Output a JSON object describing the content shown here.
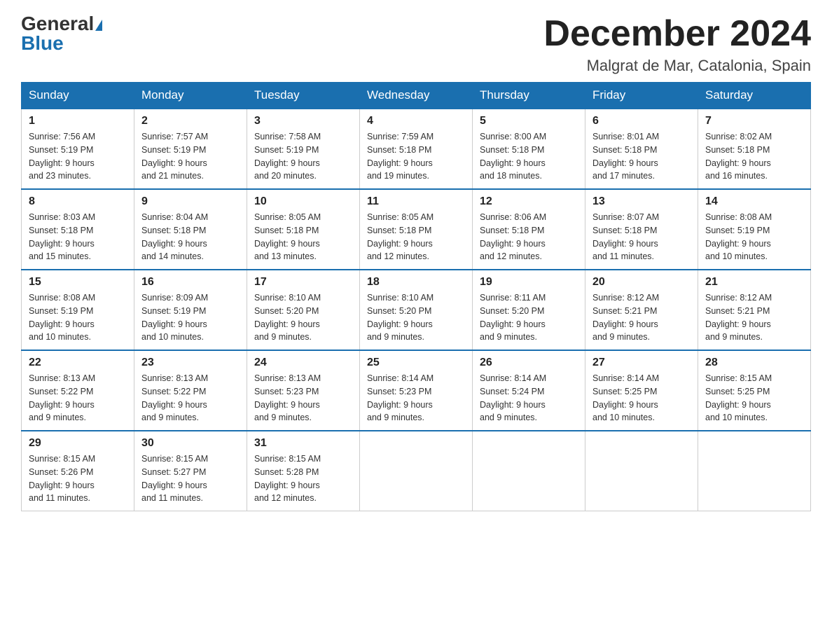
{
  "logo": {
    "general": "General",
    "blue": "Blue"
  },
  "header": {
    "month": "December 2024",
    "location": "Malgrat de Mar, Catalonia, Spain"
  },
  "weekdays": [
    "Sunday",
    "Monday",
    "Tuesday",
    "Wednesday",
    "Thursday",
    "Friday",
    "Saturday"
  ],
  "weeks": [
    [
      {
        "day": "1",
        "sunrise": "7:56 AM",
        "sunset": "5:19 PM",
        "daylight": "9 hours and 23 minutes."
      },
      {
        "day": "2",
        "sunrise": "7:57 AM",
        "sunset": "5:19 PM",
        "daylight": "9 hours and 21 minutes."
      },
      {
        "day": "3",
        "sunrise": "7:58 AM",
        "sunset": "5:19 PM",
        "daylight": "9 hours and 20 minutes."
      },
      {
        "day": "4",
        "sunrise": "7:59 AM",
        "sunset": "5:18 PM",
        "daylight": "9 hours and 19 minutes."
      },
      {
        "day": "5",
        "sunrise": "8:00 AM",
        "sunset": "5:18 PM",
        "daylight": "9 hours and 18 minutes."
      },
      {
        "day": "6",
        "sunrise": "8:01 AM",
        "sunset": "5:18 PM",
        "daylight": "9 hours and 17 minutes."
      },
      {
        "day": "7",
        "sunrise": "8:02 AM",
        "sunset": "5:18 PM",
        "daylight": "9 hours and 16 minutes."
      }
    ],
    [
      {
        "day": "8",
        "sunrise": "8:03 AM",
        "sunset": "5:18 PM",
        "daylight": "9 hours and 15 minutes."
      },
      {
        "day": "9",
        "sunrise": "8:04 AM",
        "sunset": "5:18 PM",
        "daylight": "9 hours and 14 minutes."
      },
      {
        "day": "10",
        "sunrise": "8:05 AM",
        "sunset": "5:18 PM",
        "daylight": "9 hours and 13 minutes."
      },
      {
        "day": "11",
        "sunrise": "8:05 AM",
        "sunset": "5:18 PM",
        "daylight": "9 hours and 12 minutes."
      },
      {
        "day": "12",
        "sunrise": "8:06 AM",
        "sunset": "5:18 PM",
        "daylight": "9 hours and 12 minutes."
      },
      {
        "day": "13",
        "sunrise": "8:07 AM",
        "sunset": "5:18 PM",
        "daylight": "9 hours and 11 minutes."
      },
      {
        "day": "14",
        "sunrise": "8:08 AM",
        "sunset": "5:19 PM",
        "daylight": "9 hours and 10 minutes."
      }
    ],
    [
      {
        "day": "15",
        "sunrise": "8:08 AM",
        "sunset": "5:19 PM",
        "daylight": "9 hours and 10 minutes."
      },
      {
        "day": "16",
        "sunrise": "8:09 AM",
        "sunset": "5:19 PM",
        "daylight": "9 hours and 10 minutes."
      },
      {
        "day": "17",
        "sunrise": "8:10 AM",
        "sunset": "5:20 PM",
        "daylight": "9 hours and 9 minutes."
      },
      {
        "day": "18",
        "sunrise": "8:10 AM",
        "sunset": "5:20 PM",
        "daylight": "9 hours and 9 minutes."
      },
      {
        "day": "19",
        "sunrise": "8:11 AM",
        "sunset": "5:20 PM",
        "daylight": "9 hours and 9 minutes."
      },
      {
        "day": "20",
        "sunrise": "8:12 AM",
        "sunset": "5:21 PM",
        "daylight": "9 hours and 9 minutes."
      },
      {
        "day": "21",
        "sunrise": "8:12 AM",
        "sunset": "5:21 PM",
        "daylight": "9 hours and 9 minutes."
      }
    ],
    [
      {
        "day": "22",
        "sunrise": "8:13 AM",
        "sunset": "5:22 PM",
        "daylight": "9 hours and 9 minutes."
      },
      {
        "day": "23",
        "sunrise": "8:13 AM",
        "sunset": "5:22 PM",
        "daylight": "9 hours and 9 minutes."
      },
      {
        "day": "24",
        "sunrise": "8:13 AM",
        "sunset": "5:23 PM",
        "daylight": "9 hours and 9 minutes."
      },
      {
        "day": "25",
        "sunrise": "8:14 AM",
        "sunset": "5:23 PM",
        "daylight": "9 hours and 9 minutes."
      },
      {
        "day": "26",
        "sunrise": "8:14 AM",
        "sunset": "5:24 PM",
        "daylight": "9 hours and 9 minutes."
      },
      {
        "day": "27",
        "sunrise": "8:14 AM",
        "sunset": "5:25 PM",
        "daylight": "9 hours and 10 minutes."
      },
      {
        "day": "28",
        "sunrise": "8:15 AM",
        "sunset": "5:25 PM",
        "daylight": "9 hours and 10 minutes."
      }
    ],
    [
      {
        "day": "29",
        "sunrise": "8:15 AM",
        "sunset": "5:26 PM",
        "daylight": "9 hours and 11 minutes."
      },
      {
        "day": "30",
        "sunrise": "8:15 AM",
        "sunset": "5:27 PM",
        "daylight": "9 hours and 11 minutes."
      },
      {
        "day": "31",
        "sunrise": "8:15 AM",
        "sunset": "5:28 PM",
        "daylight": "9 hours and 12 minutes."
      },
      null,
      null,
      null,
      null
    ]
  ],
  "labels": {
    "sunrise": "Sunrise:",
    "sunset": "Sunset:",
    "daylight": "Daylight:"
  }
}
